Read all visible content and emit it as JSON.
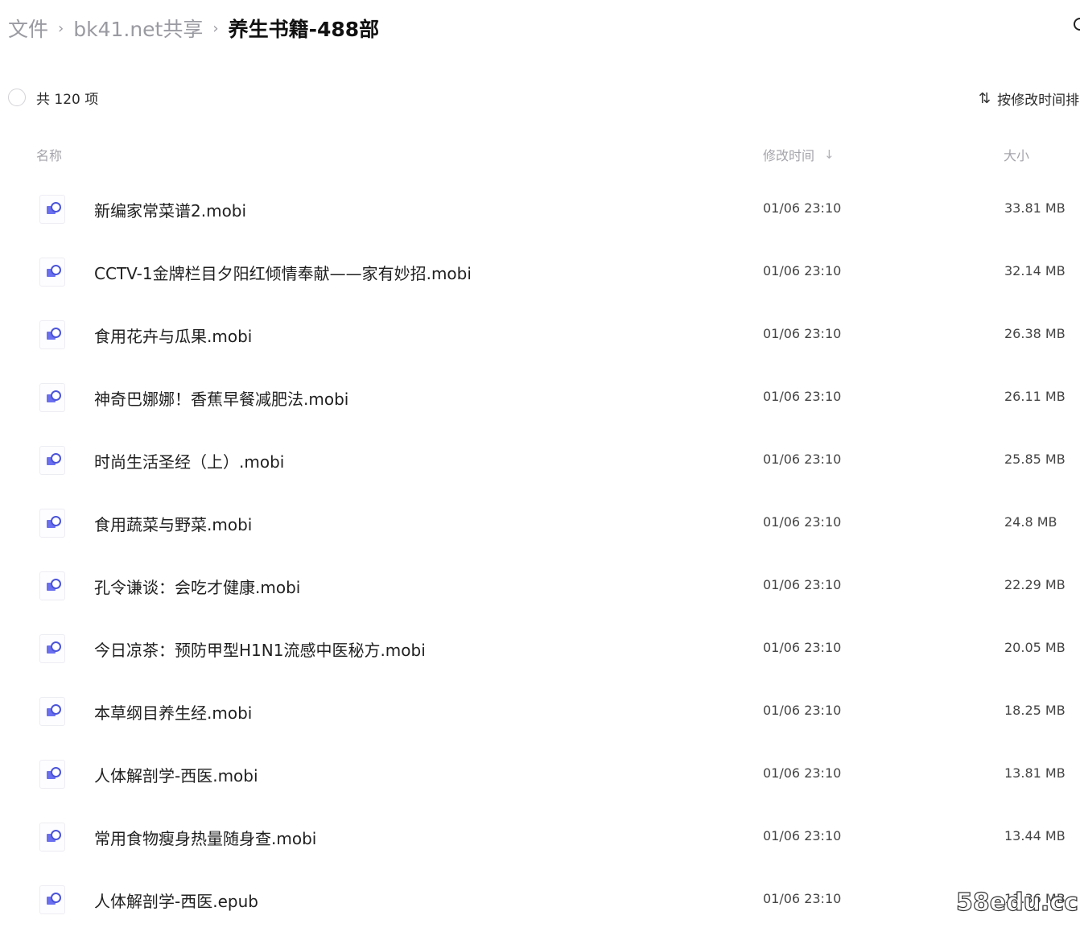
{
  "breadcrumb": {
    "items": [
      "文件",
      "bk41.net共享"
    ],
    "separator": "›",
    "current": "养生书籍-488部"
  },
  "toolbar": {
    "item_count": "共 120 项",
    "sort_icon": "⇅",
    "sort_label": "按修改时间排"
  },
  "columns": {
    "name": "名称",
    "modified": "修改时间",
    "modified_sort_arrow": "↓",
    "size": "大小"
  },
  "files": [
    {
      "name": "新编家常菜谱2.mobi",
      "modified": "01/06 23:10",
      "size": "33.81 MB"
    },
    {
      "name": "CCTV-1金牌栏目夕阳红倾情奉献——家有妙招.mobi",
      "modified": "01/06 23:10",
      "size": "32.14 MB"
    },
    {
      "name": "食用花卉与瓜果.mobi",
      "modified": "01/06 23:10",
      "size": "26.38 MB"
    },
    {
      "name": "神奇巴娜娜！香蕉早餐减肥法.mobi",
      "modified": "01/06 23:10",
      "size": "26.11 MB"
    },
    {
      "name": "时尚生活圣经（上）.mobi",
      "modified": "01/06 23:10",
      "size": "25.85 MB"
    },
    {
      "name": "食用蔬菜与野菜.mobi",
      "modified": "01/06 23:10",
      "size": "24.8 MB"
    },
    {
      "name": "孔令谦谈：会吃才健康.mobi",
      "modified": "01/06 23:10",
      "size": "22.29 MB"
    },
    {
      "name": "今日凉茶：预防甲型H1N1流感中医秘方.mobi",
      "modified": "01/06 23:10",
      "size": "20.05 MB"
    },
    {
      "name": "本草纲目养生经.mobi",
      "modified": "01/06 23:10",
      "size": "18.25 MB"
    },
    {
      "name": "人体解剖学-西医.mobi",
      "modified": "01/06 23:10",
      "size": "13.81 MB"
    },
    {
      "name": "常用食物瘦身热量随身查.mobi",
      "modified": "01/06 23:10",
      "size": "13.44 MB"
    },
    {
      "name": "人体解剖学-西医.epub",
      "modified": "01/06 23:10",
      "size": "13.36 MB"
    }
  ],
  "watermark": "58edu.cc",
  "colors": {
    "icon_primary": "#4b54d9",
    "icon_secondary": "#6a6ff0",
    "muted_text": "#9a9aa2"
  }
}
